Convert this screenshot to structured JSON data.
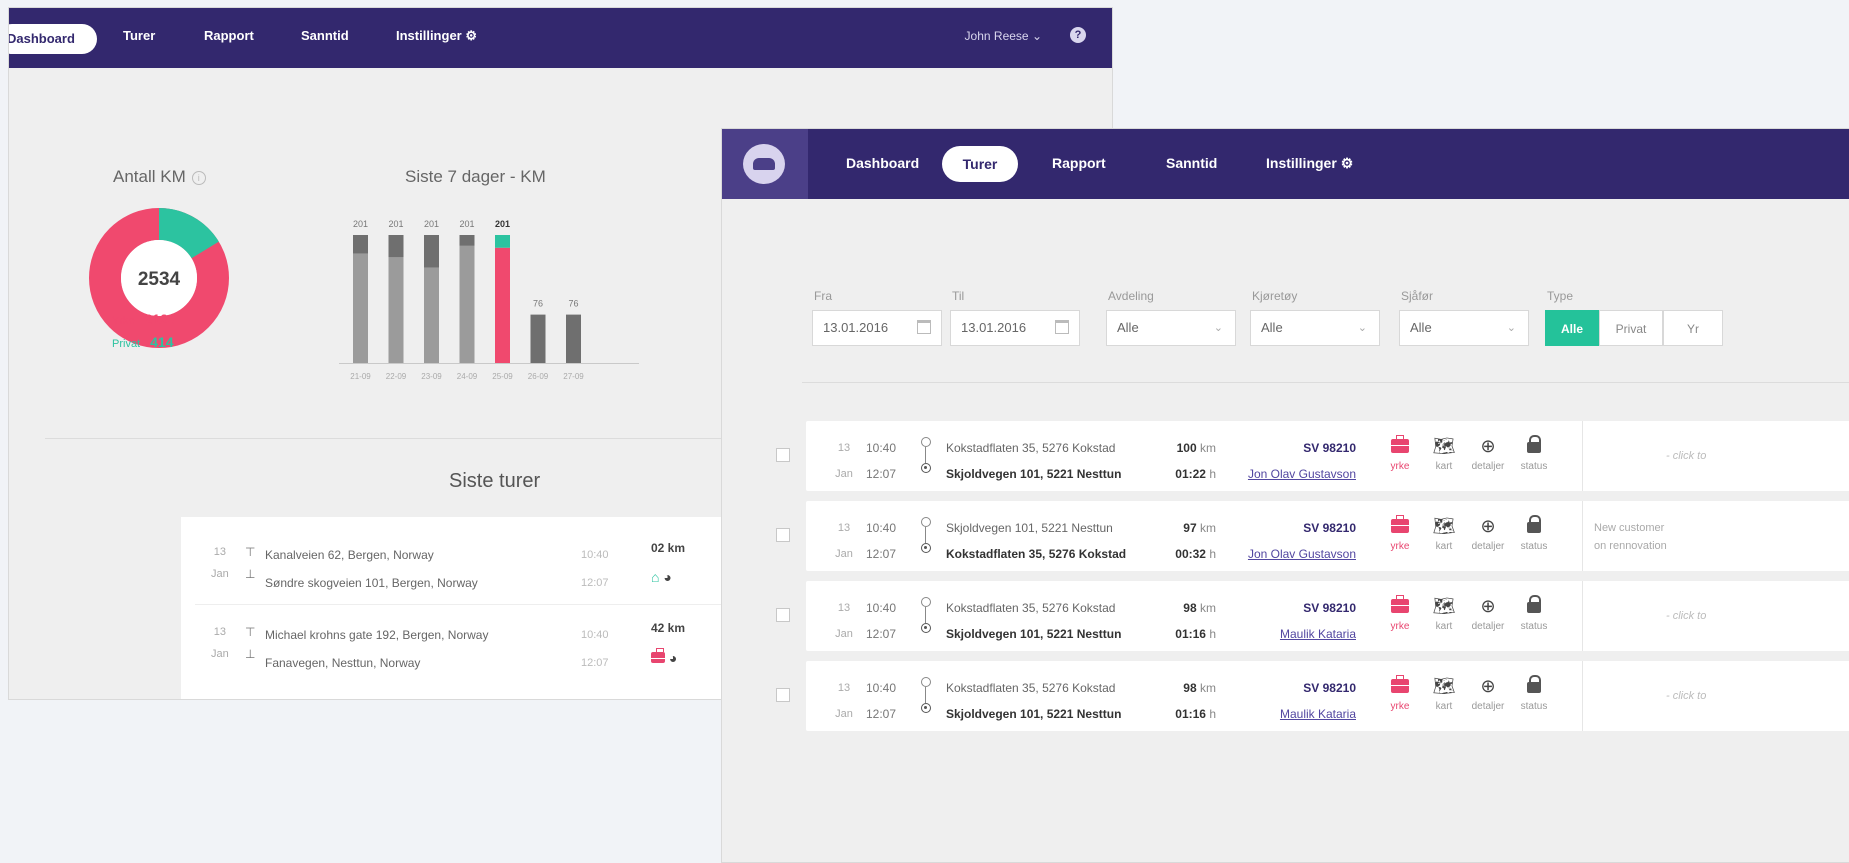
{
  "back": {
    "nav": {
      "active": "Dashboard",
      "items": [
        "Turer",
        "Rapport",
        "Sanntid",
        "Instillinger"
      ],
      "user": "John Reese",
      "help": "?"
    },
    "antall": {
      "title": "Antall KM",
      "total": "2534",
      "yrke_label": "Yrke",
      "yrke_value": "2120",
      "privat_label": "Privat",
      "privat_value": "414"
    },
    "bars_title": "Siste 7 dager - KM",
    "trips_title": "Siste turer",
    "trips": [
      {
        "day": "13",
        "month": "Jan",
        "from": "Kanalveien 62, Bergen, Norway",
        "to": "Søndre skogveien 101, Bergen, Norway",
        "t1": "10:40",
        "t2": "12:07",
        "km": "02 km",
        "type_icon": "home-icon"
      },
      {
        "day": "13",
        "month": "Jan",
        "from": "Michael krohns gate 192, Bergen, Norway",
        "to": "Fanavegen, Nesttun, Norway",
        "t1": "10:40",
        "t2": "12:07",
        "km": "42 km",
        "type_icon": "briefcase-icon"
      }
    ]
  },
  "chart_data": {
    "type": "bar",
    "title": "Siste 7 dager - KM",
    "categories": [
      "21-09",
      "22-09",
      "23-09",
      "24-09",
      "25-09",
      "26-09",
      "27-09"
    ],
    "value_labels": [
      "201",
      "201",
      "201",
      "201",
      "201",
      "76",
      "76"
    ],
    "series": [
      {
        "name": "",
        "values": [
          172,
          166,
          150,
          184,
          181,
          0,
          0
        ]
      },
      {
        "name": "",
        "values": [
          29,
          35,
          51,
          17,
          20,
          0,
          0
        ]
      }
    ],
    "other_values": [
      0,
      0,
      0,
      0,
      0,
      76,
      76
    ],
    "highlight_index": 4,
    "colors": {
      "base": "#9b9b9b",
      "top": "#6f6f6f",
      "highlight_base": "#f0496e",
      "highlight_top": "#2cc3a0",
      "small": "#6f6f6f"
    },
    "ylim": [
      0,
      201
    ]
  },
  "front": {
    "nav": {
      "items": [
        "Dashboard",
        "Turer",
        "Rapport",
        "Sanntid",
        "Instillinger"
      ],
      "active": "Turer"
    },
    "filters": {
      "fra_label": "Fra",
      "fra_value": "13.01.2016",
      "til_label": "Til",
      "til_value": "13.01.2016",
      "avdeling_label": "Avdeling",
      "avdeling_value": "Alle",
      "kjoretoy_label": "Kjøretøy",
      "kjoretoy_value": "Alle",
      "sjafor_label": "Sjåfør",
      "sjafor_value": "Alle",
      "type_label": "Type",
      "type_options": [
        "Alle",
        "Privat",
        "Yr"
      ]
    },
    "action_labels": {
      "yrke": "yrke",
      "kart": "kart",
      "detaljer": "detaljer",
      "status": "status"
    },
    "trips": [
      {
        "day": "13",
        "month": "Jan",
        "t1": "10:40",
        "t2": "12:07",
        "from": "Kokstadflaten 35, 5276 Kokstad",
        "to": "Skjoldvegen 101, 5221 Nesttun",
        "km": "100",
        "km_unit": "km",
        "dur": "01:22",
        "dur_unit": "h",
        "reg": "SV 98210",
        "driver": "Jon Olav Gustavson",
        "comment1": "",
        "comment2": "",
        "hint": "- click to"
      },
      {
        "day": "13",
        "month": "Jan",
        "t1": "10:40",
        "t2": "12:07",
        "from": "Skjoldvegen 101, 5221 Nesttun",
        "to": "Kokstadflaten 35, 5276 Kokstad",
        "km": "97",
        "km_unit": "km",
        "dur": "00:32",
        "dur_unit": "h",
        "reg": "SV 98210",
        "driver": "Jon Olav Gustavson",
        "comment1": "New customer",
        "comment2": "on rennovation",
        "hint": ""
      },
      {
        "day": "13",
        "month": "Jan",
        "t1": "10:40",
        "t2": "12:07",
        "from": "Kokstadflaten 35, 5276 Kokstad",
        "to": "Skjoldvegen 101, 5221 Nesttun",
        "km": "98",
        "km_unit": "km",
        "dur": "01:16",
        "dur_unit": "h",
        "reg": "SV 98210",
        "driver": "Maulik Kataria",
        "comment1": "",
        "comment2": "",
        "hint": "- click to"
      },
      {
        "day": "13",
        "month": "Jan",
        "t1": "10:40",
        "t2": "12:07",
        "from": "Kokstadflaten 35, 5276 Kokstad",
        "to": "Skjoldvegen 101, 5221 Nesttun",
        "km": "98",
        "km_unit": "km",
        "dur": "01:16",
        "dur_unit": "h",
        "reg": "SV 98210",
        "driver": "Maulik Kataria",
        "comment1": "",
        "comment2": "",
        "hint": "- click to"
      }
    ]
  }
}
